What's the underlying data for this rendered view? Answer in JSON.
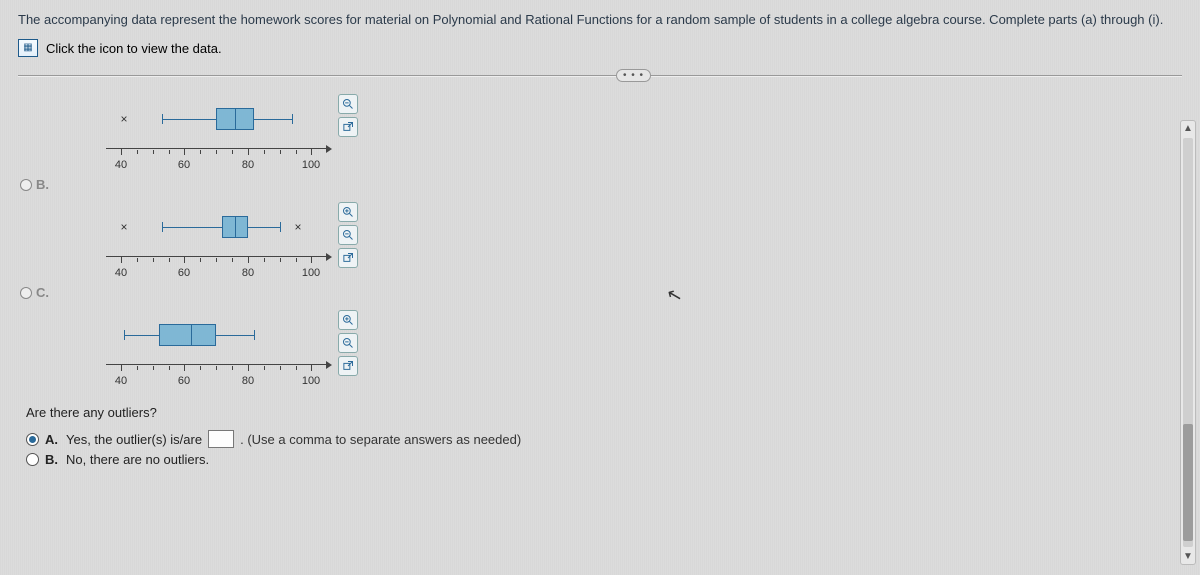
{
  "intro": "The accompanying data represent the homework scores for material on Polynomial and Rational Functions for a random sample of students in a college algebra course. Complete parts (a) through (i).",
  "data_link_label": "Click the icon to view the data.",
  "axis_ticks": [
    "40",
    "60",
    "80",
    "100"
  ],
  "options": {
    "B": "B.",
    "C": "C."
  },
  "question": "Are there any outliers?",
  "answers": {
    "A_letter": "A.",
    "A_text_before": "Yes, the outlier(s) is/are",
    "A_hint": ". (Use a comma to separate answers as needed)",
    "B_letter": "B.",
    "B_text": "No, there are no outliers."
  },
  "divider_label": "• • •",
  "chart_data": [
    {
      "type": "boxplot",
      "xlim": [
        40,
        100
      ],
      "xticks": [
        40,
        60,
        80,
        100
      ],
      "outliers": [
        41
      ],
      "whisker_low": 53,
      "q1": 70,
      "median": 76,
      "q3": 82,
      "whisker_high": 94,
      "upper_fence_marker": null
    },
    {
      "type": "boxplot",
      "xlim": [
        40,
        100
      ],
      "xticks": [
        40,
        60,
        80,
        100
      ],
      "outliers": [
        41
      ],
      "whisker_low": 53,
      "q1": 72,
      "median": 76,
      "q3": 80,
      "whisker_high": 90,
      "upper_fence_marker": 96
    },
    {
      "type": "boxplot",
      "xlim": [
        40,
        100
      ],
      "xticks": [
        40,
        60,
        80,
        100
      ],
      "outliers": [],
      "whisker_low": 41,
      "q1": 52,
      "median": 62,
      "q3": 70,
      "whisker_high": 82,
      "upper_fence_marker": null
    }
  ]
}
